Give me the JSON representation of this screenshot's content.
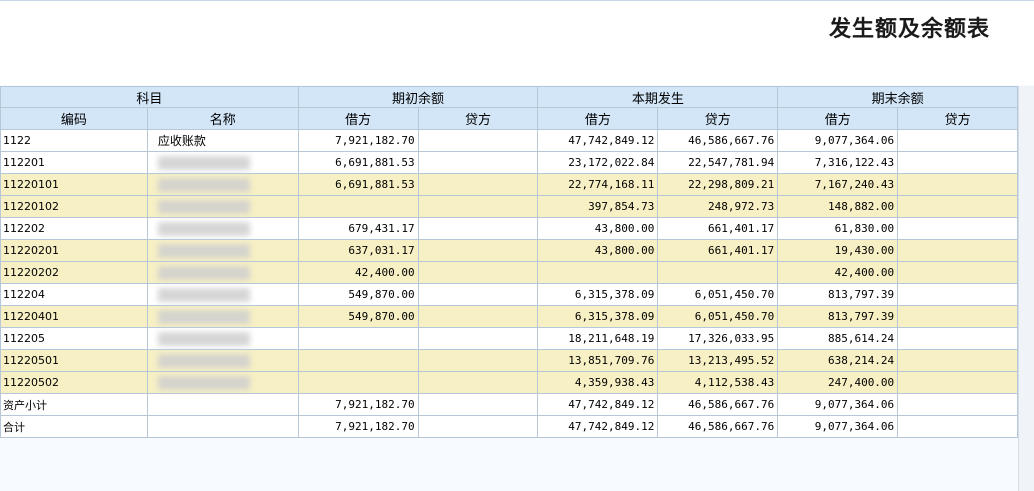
{
  "report": {
    "title": "发生额及余额表"
  },
  "header": {
    "subject": "科目",
    "opening": "期初余额",
    "current": "本期发生",
    "closing": "期末余额",
    "code": "编码",
    "name": "名称",
    "debit": "借方",
    "credit": "贷方"
  },
  "rows": [
    {
      "code": "1122",
      "name": "应收账款",
      "od": "7,921,182.70",
      "oc": "",
      "cd": "47,742,849.12",
      "cc": "46,586,667.76",
      "ed": "9,077,364.06",
      "ec": ""
    },
    {
      "code": "112201",
      "name": "",
      "od": "6,691,881.53",
      "oc": "",
      "cd": "23,172,022.84",
      "cc": "22,547,781.94",
      "ed": "7,316,122.43",
      "ec": ""
    },
    {
      "code": "11220101",
      "name": "",
      "od": "6,691,881.53",
      "oc": "",
      "cd": "22,774,168.11",
      "cc": "22,298,809.21",
      "ed": "7,167,240.43",
      "ec": ""
    },
    {
      "code": "11220102",
      "name": "",
      "od": "",
      "oc": "",
      "cd": "397,854.73",
      "cc": "248,972.73",
      "ed": "148,882.00",
      "ec": ""
    },
    {
      "code": "112202",
      "name": "",
      "od": "679,431.17",
      "oc": "",
      "cd": "43,800.00",
      "cc": "661,401.17",
      "ed": "61,830.00",
      "ec": ""
    },
    {
      "code": "11220201",
      "name": "",
      "od": "637,031.17",
      "oc": "",
      "cd": "43,800.00",
      "cc": "661,401.17",
      "ed": "19,430.00",
      "ec": ""
    },
    {
      "code": "11220202",
      "name": "",
      "od": "42,400.00",
      "oc": "",
      "cd": "",
      "cc": "",
      "ed": "42,400.00",
      "ec": ""
    },
    {
      "code": "112204",
      "name": "",
      "od": "549,870.00",
      "oc": "",
      "cd": "6,315,378.09",
      "cc": "6,051,450.70",
      "ed": "813,797.39",
      "ec": ""
    },
    {
      "code": "11220401",
      "name": "",
      "od": "549,870.00",
      "oc": "",
      "cd": "6,315,378.09",
      "cc": "6,051,450.70",
      "ed": "813,797.39",
      "ec": ""
    },
    {
      "code": "112205",
      "name": "",
      "od": "",
      "oc": "",
      "cd": "18,211,648.19",
      "cc": "17,326,033.95",
      "ed": "885,614.24",
      "ec": ""
    },
    {
      "code": "11220501",
      "name": "",
      "od": "",
      "oc": "",
      "cd": "13,851,709.76",
      "cc": "13,213,495.52",
      "ed": "638,214.24",
      "ec": ""
    },
    {
      "code": "11220502",
      "name": "",
      "od": "",
      "oc": "",
      "cd": "4,359,938.43",
      "cc": "4,112,538.43",
      "ed": "247,400.00",
      "ec": ""
    },
    {
      "code": "资产小计",
      "name": "",
      "od": "7,921,182.70",
      "oc": "",
      "cd": "47,742,849.12",
      "cc": "46,586,667.76",
      "ed": "9,077,364.06",
      "ec": ""
    },
    {
      "code": "合计",
      "name": "",
      "od": "7,921,182.70",
      "oc": "",
      "cd": "47,742,849.12",
      "cc": "46,586,667.76",
      "ed": "9,077,364.06",
      "ec": ""
    }
  ]
}
